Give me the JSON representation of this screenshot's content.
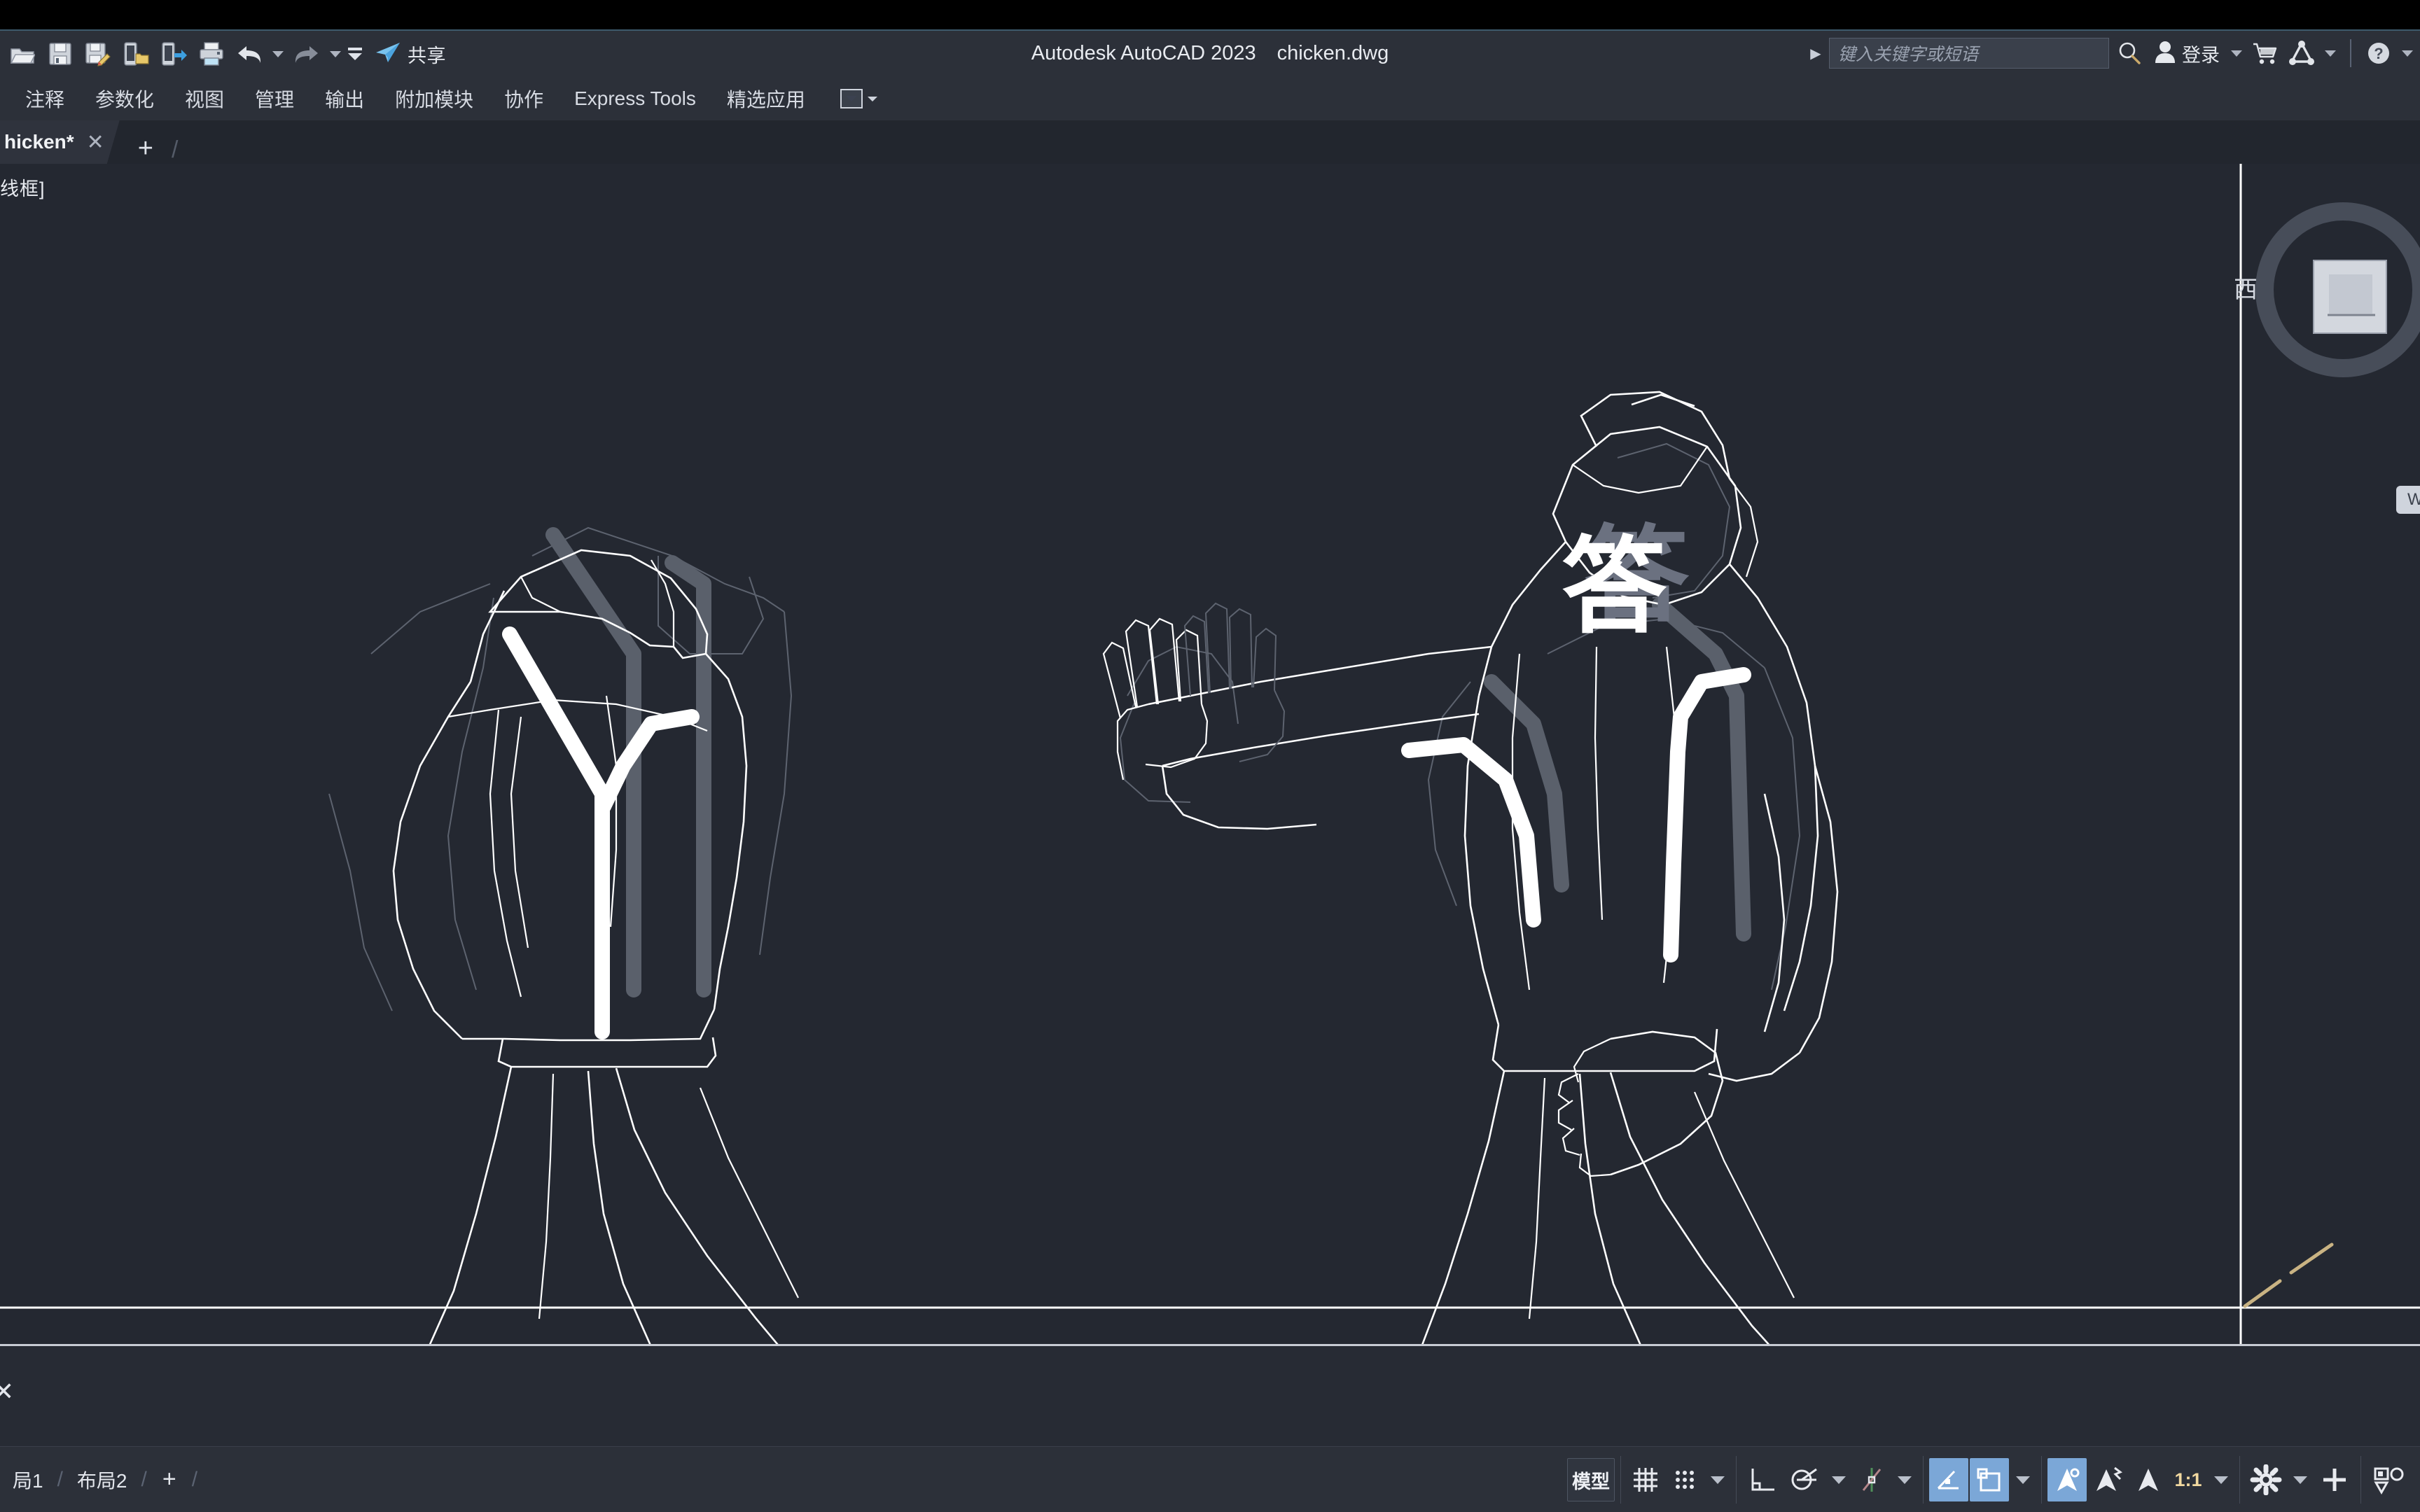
{
  "window": {
    "app_title": "Autodesk AutoCAD 2023",
    "document_title": "chicken.dwg"
  },
  "quick_access": {
    "icons": [
      {
        "name": "open-icon",
        "label": "打开"
      },
      {
        "name": "save-icon",
        "label": "保存"
      },
      {
        "name": "save-as-icon",
        "label": "另存为"
      },
      {
        "name": "save-to-web-icon",
        "label": "保存到 Web"
      },
      {
        "name": "open-from-web-icon",
        "label": "从 Web 打开"
      },
      {
        "name": "plot-icon",
        "label": "打印"
      }
    ],
    "undo_label": "放弃",
    "redo_label": "重做",
    "more_label": "更多",
    "share_label": "共享"
  },
  "search": {
    "placeholder": "键入关键字或短语",
    "search_icon": "search-icon"
  },
  "account": {
    "signin_label": "登录",
    "cart_icon": "shopping-cart-icon",
    "autodesk_icon": "autodesk-logo-icon",
    "help_icon": "help-icon"
  },
  "ribbon": {
    "tabs": [
      {
        "label": "注释"
      },
      {
        "label": "参数化"
      },
      {
        "label": "视图"
      },
      {
        "label": "管理"
      },
      {
        "label": "输出"
      },
      {
        "label": "附加模块"
      },
      {
        "label": "协作"
      },
      {
        "label": "Express Tools"
      },
      {
        "label": "精选应用"
      }
    ],
    "overflow_label": "面板展开"
  },
  "file_tabs": {
    "tabs": [
      {
        "label": "hicken*",
        "close": "✕",
        "modified": true
      }
    ],
    "add_label": "+",
    "separator": "/"
  },
  "canvas": {
    "viewport_label": "线框]",
    "annotation_character": "答",
    "ghost_character": "答",
    "background_color": "#242831",
    "line_color": "#ffffff",
    "ghost_line_color": "#6e7480",
    "accent_color": "#c9b383",
    "viewcube": {
      "west_label": "西",
      "wcs_label": "WCS"
    }
  },
  "command_line": {
    "close_glyph": "✕",
    "value": "",
    "placeholder": ""
  },
  "status_bar": {
    "layout_tabs": [
      {
        "label": "局1"
      },
      {
        "label": "布局2"
      }
    ],
    "layout_separator": "/",
    "layout_add": "+",
    "model_label": "模型",
    "scale_label": "1:1",
    "tools": [
      {
        "name": "grid-display-icon",
        "active": false
      },
      {
        "name": "snap-mode-icon",
        "active": false
      },
      {
        "name": "ortho-mode-icon",
        "active": false
      },
      {
        "name": "polar-tracking-icon",
        "active": false
      },
      {
        "name": "object-snap-tracking-icon",
        "active": false
      },
      {
        "name": "object-snap-icon",
        "active": true
      },
      {
        "name": "annotation-visibility-icon",
        "active": true
      },
      {
        "name": "autoscale-icon",
        "active": true
      },
      {
        "name": "annotation-scale-icon",
        "active": false
      },
      {
        "name": "workspace-switching-icon",
        "active": false
      },
      {
        "name": "customization-icon",
        "active": false
      },
      {
        "name": "hardware-accel-icon",
        "active": false
      }
    ]
  }
}
